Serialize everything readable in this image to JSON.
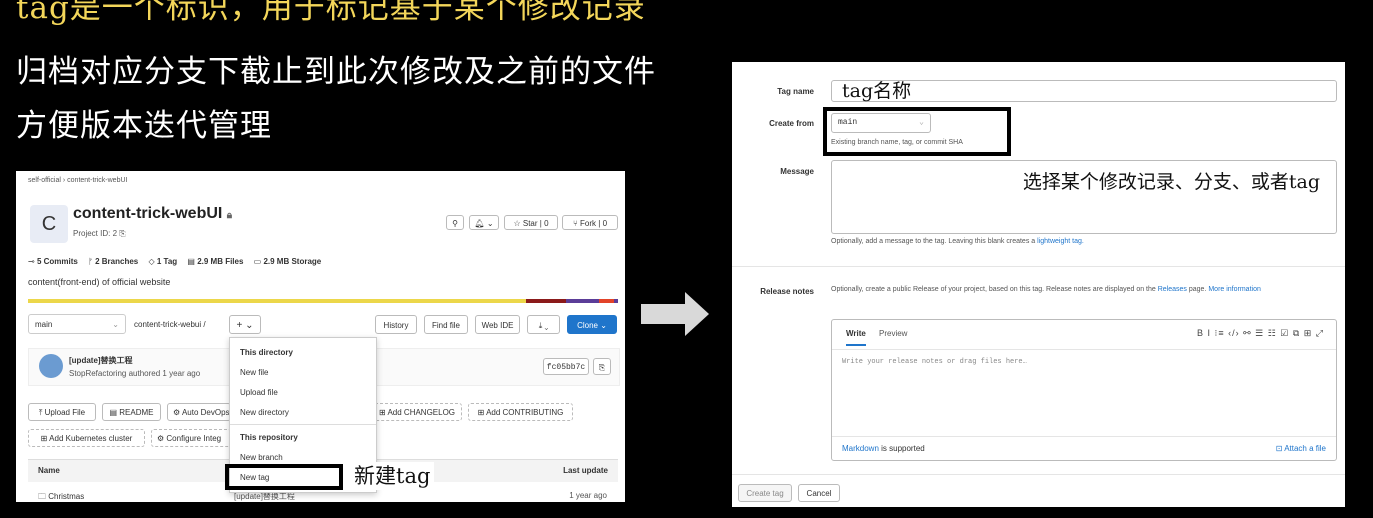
{
  "slide": {
    "line1": "tag是一个标识，用于标记基于某个修改记录",
    "line2": "归档对应分支下截止到此次修改及之前的文件",
    "line3": "方便版本迭代管理"
  },
  "left": {
    "breadcrumb": "self-official  ›  content-trick-webUI",
    "avatar_letter": "C",
    "project_title": "content-trick-webUI",
    "project_id": "Project ID: 2",
    "star_label": "☆ Star",
    "star_count": "0",
    "fork_label": "Fork",
    "fork_count": "0",
    "stats": {
      "commits": "5 Commits",
      "branches": "2 Branches",
      "tags": "1 Tag",
      "files": "2.9 MB Files",
      "storage": "2.9 MB Storage"
    },
    "description": "content(front-end) of official website",
    "branch_select": "main",
    "path": "content-trick-webui  /",
    "plus_button": "+ ⌄",
    "history_button": "History",
    "find_file_button": "Find file",
    "web_ide_button": "Web IDE",
    "download_button": "⤓ ⌄",
    "clone_button": "Clone ⌄",
    "dropdown": {
      "header1": "This directory",
      "new_file": "New file",
      "upload_file": "Upload file",
      "new_directory": "New directory",
      "header2": "This repository",
      "new_branch": "New branch",
      "new_tag": "New tag"
    },
    "annotation_new_tag": "新建tag",
    "commit": {
      "title": "[update]替换工程",
      "meta": "StopRefactoring authored 1 year ago",
      "sha": "fc05bb7c"
    },
    "actions": {
      "upload_file": "Upload File",
      "readme": "README",
      "auto_devops": "Auto DevOps",
      "add_changelog": "Add CHANGELOG",
      "add_contributing": "Add CONTRIBUTING",
      "add_k8s": "Add Kubernetes cluster",
      "configure": "Configure Integ"
    },
    "table": {
      "col_name": "Name",
      "col_last_update": "Last update",
      "row1_name": "Christmas",
      "row1_commit": "[update]替换工程",
      "row1_time": "1 year ago"
    },
    "colors": {
      "langbar_yellow": "#ecd74a",
      "langbar_red": "#8b1a1a",
      "langbar_purple": "#5b3d98",
      "langbar_orange": "#e24329",
      "clone_blue": "#1f75cb"
    }
  },
  "right": {
    "tag_name_label": "Tag name",
    "tag_name_value": "tag名称",
    "create_from_label": "Create from",
    "create_from_value": "main",
    "create_from_hint": "Existing branch name, tag, or commit SHA",
    "message_label": "Message",
    "message_annotation": "选择某个修改记录、分支、或者tag",
    "message_hint_prefix": "Optionally, add a message to the tag. Leaving this blank creates a ",
    "message_hint_link": "lightweight tag.",
    "release_notes_label": "Release notes",
    "release_hint_prefix": "Optionally, create a public Release of your project, based on this tag. Release notes are displayed on the ",
    "release_hint_link1": "Releases",
    "release_hint_mid": " page. ",
    "release_hint_link2": "More information",
    "write_tab": "Write",
    "preview_tab": "Preview",
    "toolbar_icons": "B   I   ⁝≡   ‹/›   ⚯   ☰   ☷   ☑   ⧉   ⊞   ⤢",
    "editor_placeholder": "Write your release notes or drag files here…",
    "markdown_link": "Markdown",
    "markdown_suffix": " is supported",
    "attach_file": "Attach a file",
    "create_tag_button": "Create tag",
    "cancel_button": "Cancel"
  }
}
